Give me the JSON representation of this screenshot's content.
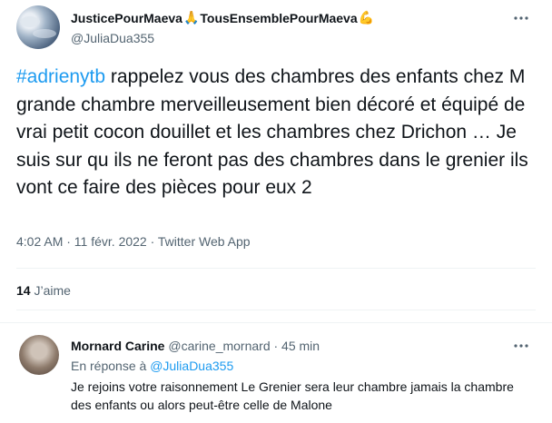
{
  "tweet": {
    "display_name": "JusticePourMaeva",
    "display_name_2": "TousEnsemblePourMaeva",
    "emoji_1": "🙏",
    "emoji_2": "💪",
    "handle": "@JuliaDua355",
    "hashtag": "#adrienytb",
    "body": " rappelez vous des chambres des enfants chez M grande chambre merveilleusement bien décoré et équipé de vrai petit cocon douillet et les chambres chez Drichon … Je suis sur qu ils ne feront pas des chambres dans le grenier ils vont ce faire des pièces pour eux 2",
    "timestamp": "4:02 AM · 11 févr. 2022 · Twitter Web App",
    "likes_count": "14",
    "likes_label": "J’aime",
    "more_icon": "more-horizontal-icon"
  },
  "reply": {
    "display_name": "Mornard Carine",
    "meta": "@carine_mornard · 45 min",
    "in_reply_label": "En réponse à",
    "in_reply_handle": "@JuliaDua355",
    "body": "Je rejoins votre raisonnement Le Grenier sera leur chambre jamais la chambre des enfants ou alors peut-être celle de Malone",
    "more_icon": "more-horizontal-icon"
  },
  "colors": {
    "link": "#1d9bf0",
    "secondary_text": "#536471",
    "primary_text": "#0f1419",
    "divider": "#eff3f4"
  }
}
